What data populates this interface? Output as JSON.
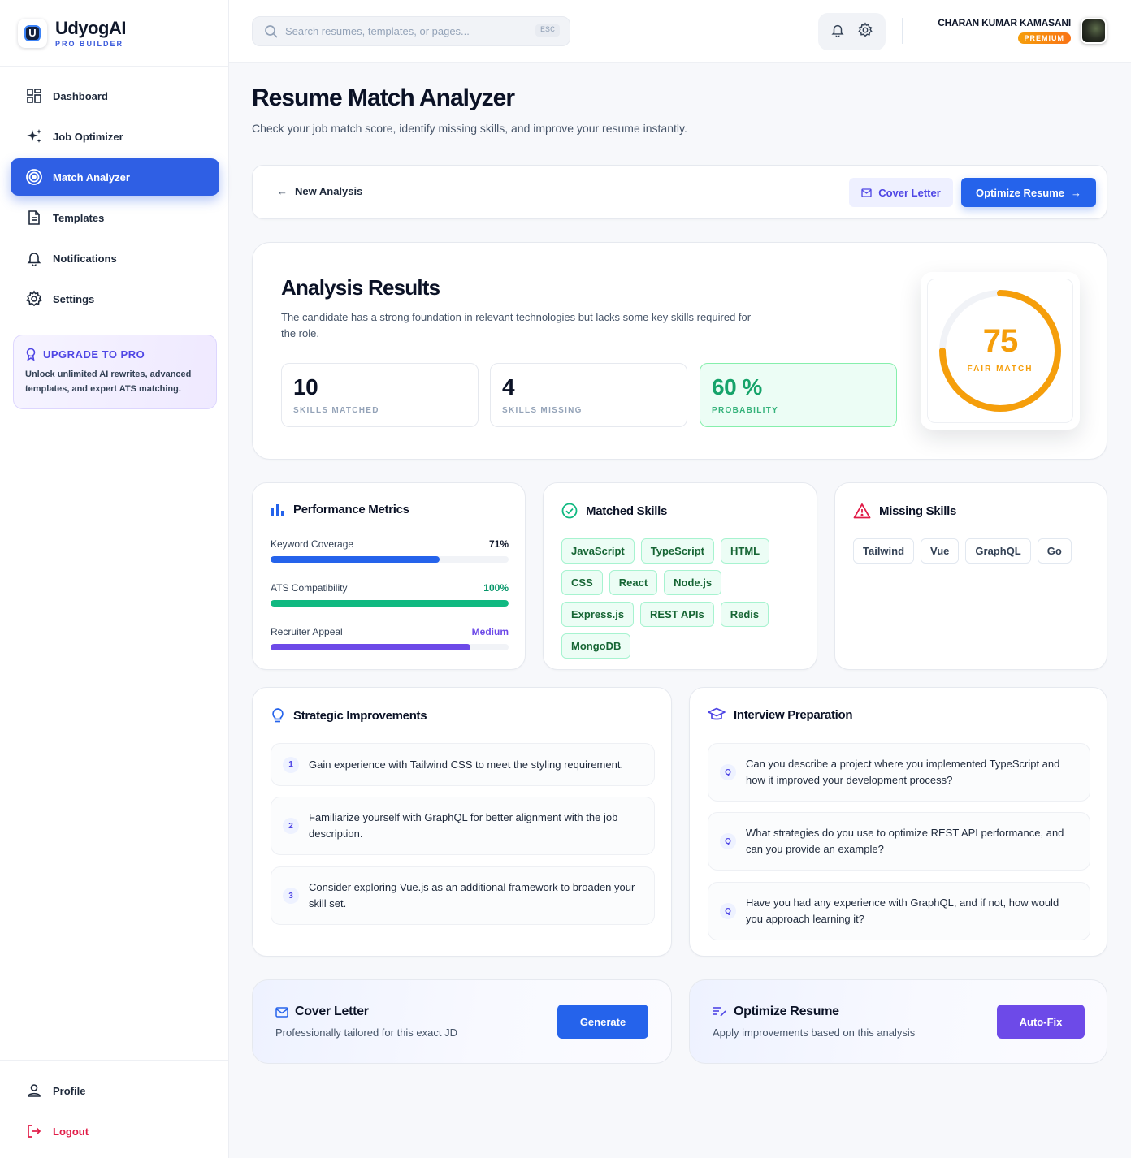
{
  "brand": {
    "name": "UdyogAI",
    "sub": "PRO BUILDER",
    "logo_letter": "U"
  },
  "sidebar": {
    "items": [
      {
        "label": "Dashboard",
        "icon": "dashboard-icon"
      },
      {
        "label": "Job Optimizer",
        "icon": "sparkles-icon"
      },
      {
        "label": "Match Analyzer",
        "icon": "target-icon",
        "active": true
      },
      {
        "label": "Templates",
        "icon": "document-icon"
      },
      {
        "label": "Notifications",
        "icon": "bell-icon"
      },
      {
        "label": "Settings",
        "icon": "gear-icon"
      }
    ],
    "upgrade": {
      "title": "UPGRADE TO PRO",
      "desc": "Unlock unlimited AI rewrites, advanced templates, and expert ATS matching."
    },
    "bottom": [
      {
        "label": "Profile",
        "icon": "user-icon"
      },
      {
        "label": "Logout",
        "icon": "logout-icon"
      }
    ]
  },
  "topbar": {
    "search_placeholder": "Search resumes, templates, or pages...",
    "esc": "ESC",
    "user_name": "CHARAN KUMAR KAMASANI",
    "badge": "PREMIUM"
  },
  "page": {
    "title": "Resume Match Analyzer",
    "subtitle": "Check your job match score, identify missing skills, and improve your resume instantly."
  },
  "actions": {
    "new_analysis": "New Analysis",
    "cover_letter": "Cover Letter",
    "optimize": "Optimize Resume"
  },
  "results": {
    "title": "Analysis Results",
    "desc": "The candidate has a strong foundation in relevant technologies but lacks some key skills required for the role.",
    "stats": [
      {
        "value": "10",
        "label": "SKILLS MATCHED"
      },
      {
        "value": "4",
        "label": "SKILLS MISSING"
      },
      {
        "value": "60 %",
        "label": "PROBABILITY"
      }
    ],
    "score": {
      "value": "75",
      "label": "FAIR MATCH",
      "fraction": 0.75,
      "color": "#f59e0b"
    }
  },
  "performance": {
    "title": "Performance Metrics",
    "metrics": [
      {
        "label": "Keyword Coverage",
        "value": "71%",
        "fill": 0.71,
        "color": "#2563eb",
        "value_color": "#0f172a"
      },
      {
        "label": "ATS Compatibility",
        "value": "100%",
        "fill": 1.0,
        "color": "#10b981",
        "value_color": "#059669"
      },
      {
        "label": "Recruiter Appeal",
        "value": "Medium",
        "fill": 0.84,
        "color": "#6d4ae8",
        "value_color": "#6d4ae8"
      }
    ]
  },
  "matched": {
    "title": "Matched Skills",
    "skills": [
      "JavaScript",
      "TypeScript",
      "HTML",
      "CSS",
      "React",
      "Node.js",
      "Express.js",
      "REST APIs",
      "Redis",
      "MongoDB"
    ]
  },
  "missing": {
    "title": "Missing Skills",
    "skills": [
      "Tailwind",
      "Vue",
      "GraphQL",
      "Go"
    ]
  },
  "strategic": {
    "title": "Strategic Improvements",
    "items": [
      {
        "num": "1",
        "text": "Gain experience with Tailwind CSS to meet the styling requirement."
      },
      {
        "num": "2",
        "text": "Familiarize yourself with GraphQL for better alignment with the job description."
      },
      {
        "num": "3",
        "text": "Consider exploring Vue.js as an additional framework to broaden your skill set."
      }
    ]
  },
  "interview": {
    "title": "Interview Preparation",
    "items": [
      {
        "num": "Q",
        "text": "Can you describe a project where you implemented TypeScript and how it improved your development process?"
      },
      {
        "num": "Q",
        "text": "What strategies do you use to optimize REST API performance, and can you provide an example?"
      },
      {
        "num": "Q",
        "text": "Have you had any experience with GraphQL, and if not, how would you approach learning it?"
      }
    ]
  },
  "bottom_cards": {
    "cover": {
      "title": "Cover Letter",
      "desc": "Professionally tailored for this exact JD",
      "button": "Generate",
      "color": "#2563eb"
    },
    "optimize": {
      "title": "Optimize Resume",
      "desc": "Apply improvements based on this analysis",
      "button": "Auto-Fix",
      "color": "#6d4ae8"
    }
  }
}
